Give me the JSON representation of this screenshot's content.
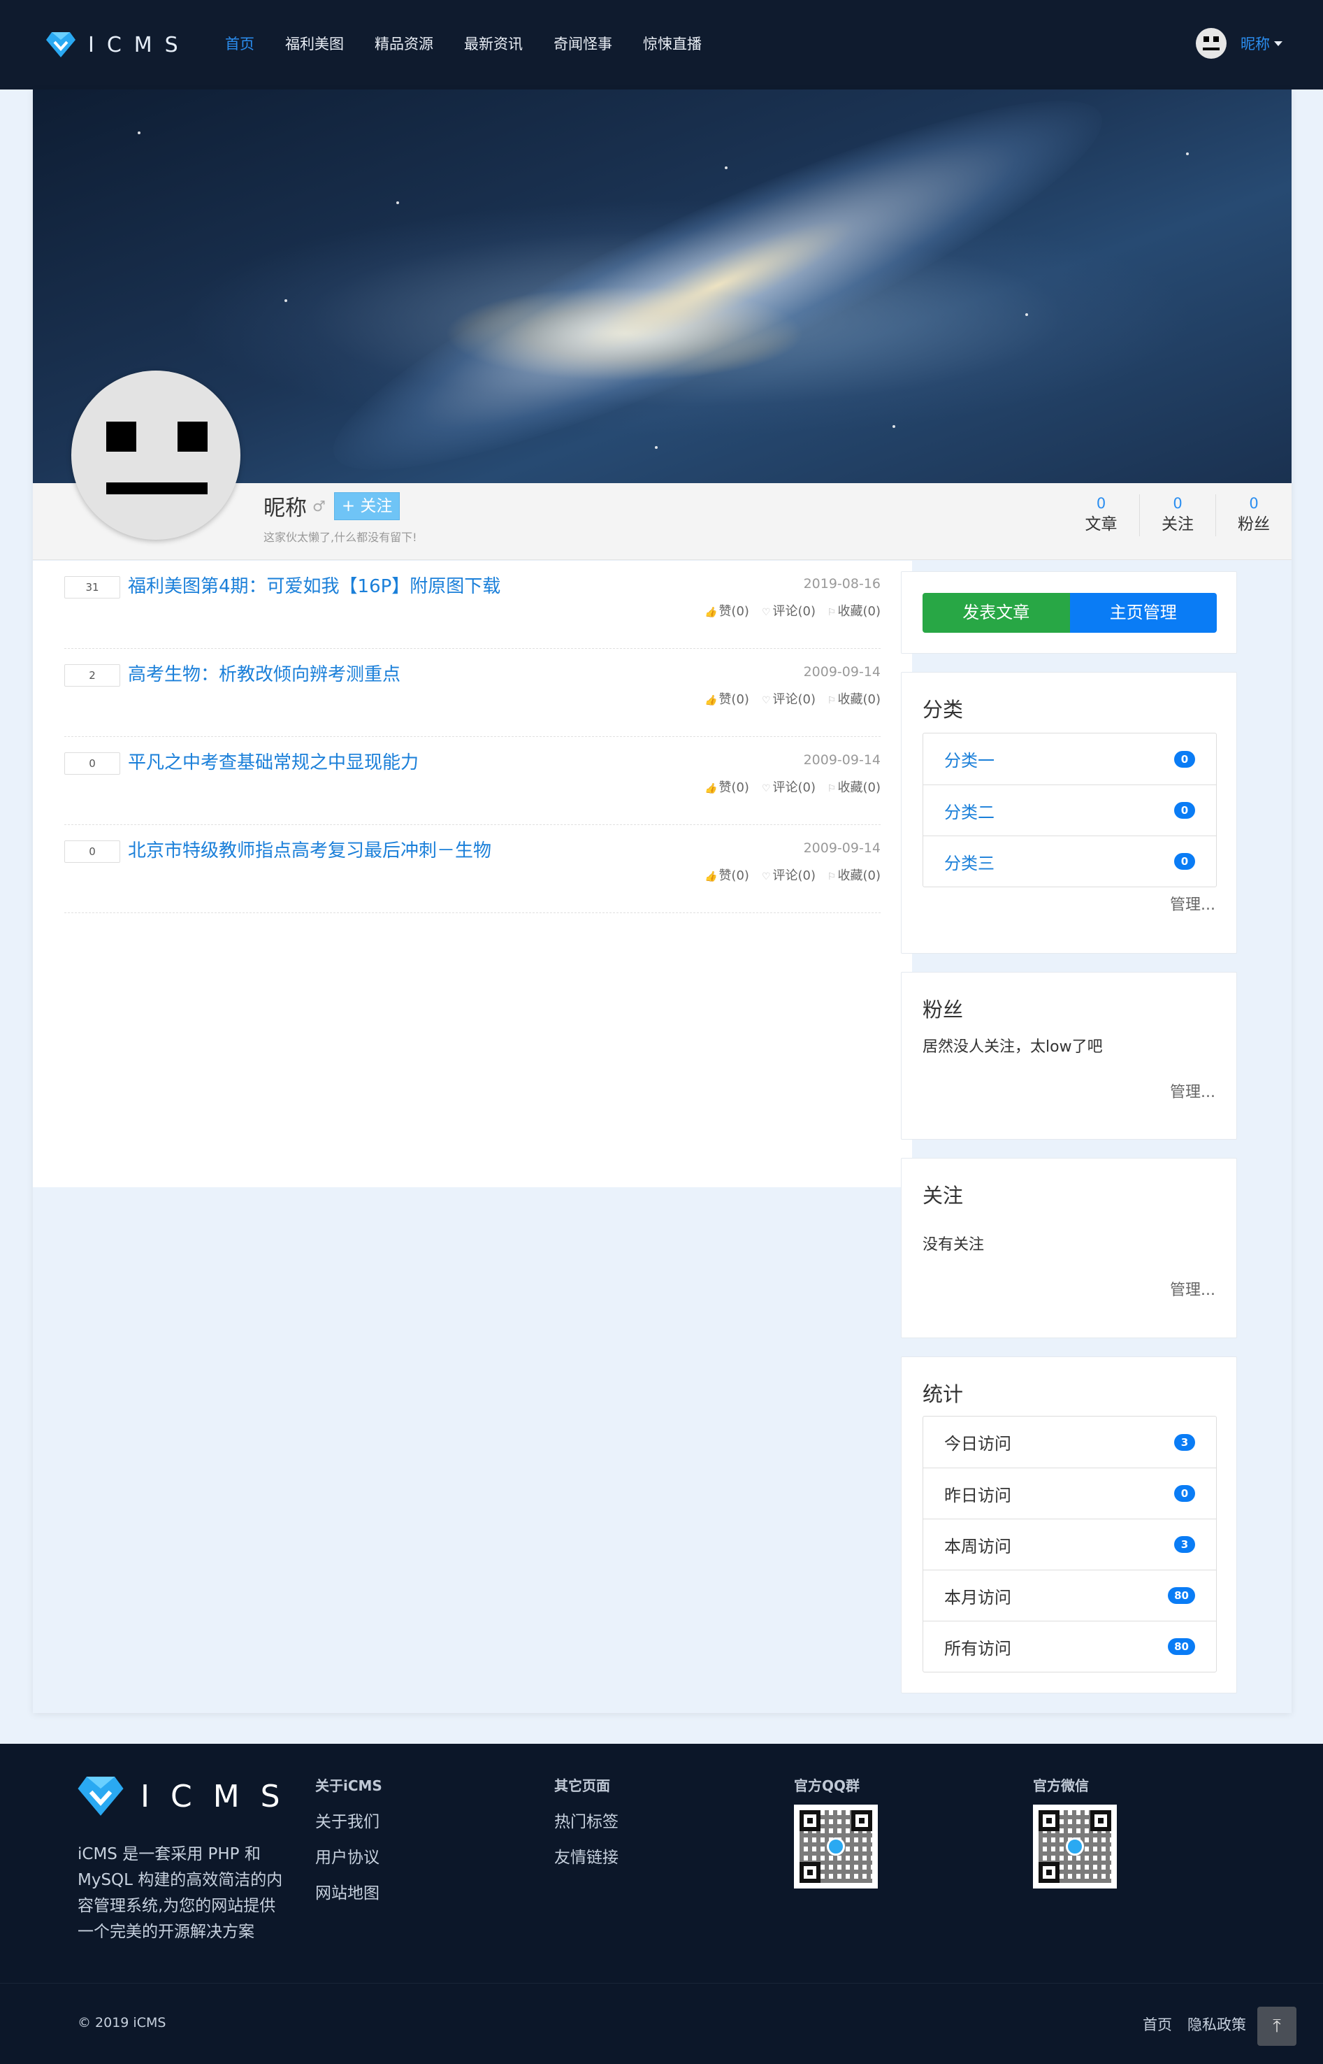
{
  "header": {
    "logo_text": "ICMS",
    "nav": [
      "首页",
      "福利美图",
      "精品资源",
      "最新资讯",
      "奇闻怪事",
      "惊悚直播"
    ],
    "active_nav": "首页",
    "user_nickname": "昵称"
  },
  "profile": {
    "name": "昵称",
    "gender_symbol": "♂",
    "follow_label": "+ 关注",
    "description": "这家伙太懒了,什么都没有留下!",
    "stats": [
      {
        "count": "0",
        "label": "文章"
      },
      {
        "count": "0",
        "label": "关注"
      },
      {
        "count": "0",
        "label": "粉丝"
      }
    ]
  },
  "articles": [
    {
      "count": "31",
      "title": "福利美图第4期：可爱如我【16P】附原图下载",
      "date": "2019-08-16",
      "like": "赞(0)",
      "comment": "评论(0)",
      "favorite": "收藏(0)"
    },
    {
      "count": "2",
      "title": "高考生物：析教改倾向辨考测重点",
      "date": "2009-09-14",
      "like": "赞(0)",
      "comment": "评论(0)",
      "favorite": "收藏(0)"
    },
    {
      "count": "0",
      "title": "平凡之中考查基础常规之中显现能力",
      "date": "2009-09-14",
      "like": "赞(0)",
      "comment": "评论(0)",
      "favorite": "收藏(0)"
    },
    {
      "count": "0",
      "title": "北京市特级教师指点高考复习最后冲刺－生物",
      "date": "2009-09-14",
      "like": "赞(0)",
      "comment": "评论(0)",
      "favorite": "收藏(0)"
    }
  ],
  "sidebar": {
    "publish_label": "发表文章",
    "manage_home_label": "主页管理",
    "category": {
      "title": "分类",
      "items": [
        {
          "label": "分类一",
          "count": "0"
        },
        {
          "label": "分类二",
          "count": "0"
        },
        {
          "label": "分类三",
          "count": "0"
        }
      ],
      "manage": "管理..."
    },
    "fans": {
      "title": "粉丝",
      "text": "居然没人关注，太low了吧",
      "manage": "管理..."
    },
    "following": {
      "title": "关注",
      "text": "没有关注",
      "manage": "管理..."
    },
    "statistics": {
      "title": "统计",
      "items": [
        {
          "label": "今日访问",
          "count": "3"
        },
        {
          "label": "昨日访问",
          "count": "0"
        },
        {
          "label": "本周访问",
          "count": "3"
        },
        {
          "label": "本月访问",
          "count": "80"
        },
        {
          "label": "所有访问",
          "count": "80"
        }
      ]
    }
  },
  "footer": {
    "logo_text": "ICMS",
    "description": "iCMS 是一套采用 PHP 和 MySQL 构建的高效简洁的内容管理系统,为您的网站提供一个完美的开源解决方案",
    "about": {
      "title": "关于iCMS",
      "links": [
        "关于我们",
        "用户协议",
        "网站地图"
      ]
    },
    "other": {
      "title": "其它页面",
      "links": [
        "热门标签",
        "友情链接"
      ]
    },
    "qq": {
      "title": "官方QQ群"
    },
    "wechat": {
      "title": "官方微信"
    },
    "copyright": "© 2019 iCMS",
    "bottom_links": [
      "首页",
      "隐私政策"
    ],
    "back_to_top": "⤒"
  },
  "colors": {
    "nav_bg": "#0f1b2e",
    "accent": "#2b8ef0",
    "green": "#28a745",
    "blue": "#0a7cf5",
    "footer_bg": "#0c1729"
  }
}
